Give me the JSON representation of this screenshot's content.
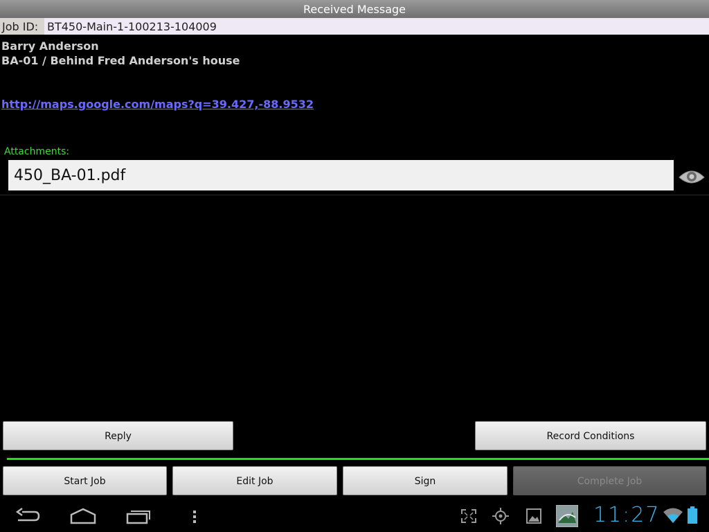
{
  "titlebar": {
    "title": "Received Message"
  },
  "job": {
    "id_label": "Job ID:",
    "id_value": "BT450-Main-1-100213-104009"
  },
  "contact": {
    "name": "Barry Anderson",
    "location": "BA-01 / Behind Fred Anderson's house"
  },
  "map_link": "http://maps.google.com/maps?q=39.427,-88.9532",
  "attachments": {
    "label": "Attachments:",
    "file": "450_BA-01.pdf"
  },
  "buttons": {
    "reply": "Reply",
    "record_conditions": "Record Conditions",
    "start_job": "Start Job",
    "edit_job": "Edit Job",
    "sign": "Sign",
    "complete_job": "Complete Job"
  },
  "status_bar": {
    "time": "11:27"
  },
  "colors": {
    "accent_green": "#22dd22",
    "link": "#6a6aff",
    "clock": "#3bb7e8"
  },
  "icons": [
    "back-icon",
    "home-icon",
    "recent-apps-icon",
    "menu-icon",
    "fullscreen-icon",
    "gps-icon",
    "gallery-icon",
    "app-notification-icon",
    "wifi-icon",
    "battery-icon",
    "eye-icon"
  ]
}
